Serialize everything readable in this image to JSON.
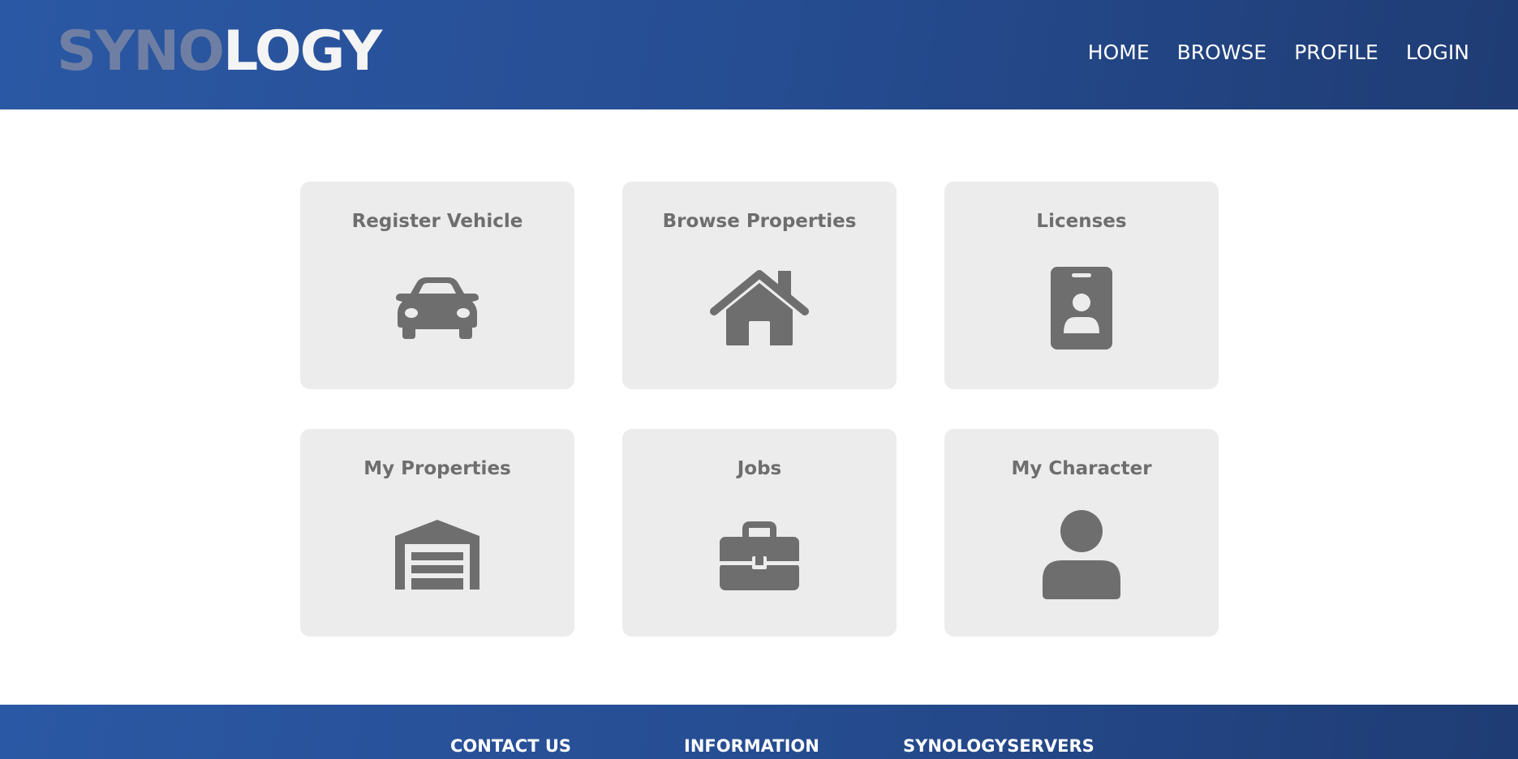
{
  "header": {
    "logo_part1": "SYNO",
    "logo_part2": "LOGY",
    "nav": [
      "HOME",
      "BROWSE",
      "PROFILE",
      "LOGIN"
    ]
  },
  "cards": [
    {
      "title": "Register Vehicle",
      "icon": "car-icon"
    },
    {
      "title": "Browse Properties",
      "icon": "house-icon"
    },
    {
      "title": "Licenses",
      "icon": "id-badge-icon"
    },
    {
      "title": "My Properties",
      "icon": "garage-icon"
    },
    {
      "title": "Jobs",
      "icon": "briefcase-icon"
    },
    {
      "title": "My Character",
      "icon": "user-icon"
    }
  ],
  "footer": {
    "contact": "CONTACT US",
    "information": "INFORMATION",
    "servers": "SYNOLOGYSERVERS"
  },
  "colors": {
    "header_gradient_start": "#2b58a4",
    "header_gradient_end": "#1f3c74",
    "card_bg": "#ececec",
    "icon_color": "#6e6e6e"
  }
}
